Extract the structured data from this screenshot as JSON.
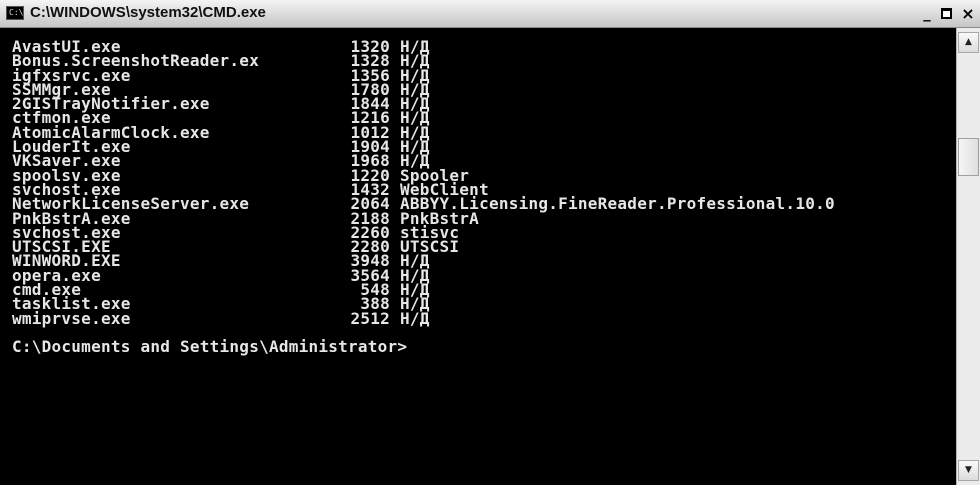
{
  "window": {
    "title": "C:\\WINDOWS\\system32\\CMD.exe",
    "icon_label": "C:\\",
    "controls": {
      "minimize": "_",
      "close": "×"
    }
  },
  "console": {
    "processes": [
      {
        "name": "AvastUI.exe",
        "pid": "1320",
        "service": "Н/Д"
      },
      {
        "name": "Bonus.ScreenshotReader.ex",
        "pid": "1328",
        "service": "Н/Д"
      },
      {
        "name": "igfxsrvc.exe",
        "pid": "1356",
        "service": "Н/Д"
      },
      {
        "name": "SSMMgr.exe",
        "pid": "1780",
        "service": "Н/Д"
      },
      {
        "name": "2GISTrayNotifier.exe",
        "pid": "1844",
        "service": "Н/Д"
      },
      {
        "name": "ctfmon.exe",
        "pid": "1216",
        "service": "Н/Д"
      },
      {
        "name": "AtomicAlarmClock.exe",
        "pid": "1012",
        "service": "Н/Д"
      },
      {
        "name": "LouderIt.exe",
        "pid": "1904",
        "service": "Н/Д"
      },
      {
        "name": "VKSaver.exe",
        "pid": "1968",
        "service": "Н/Д"
      },
      {
        "name": "spoolsv.exe",
        "pid": "1220",
        "service": "Spooler"
      },
      {
        "name": "svchost.exe",
        "pid": "1432",
        "service": "WebClient"
      },
      {
        "name": "NetworkLicenseServer.exe",
        "pid": "2064",
        "service": "ABBYY.Licensing.FineReader.Professional.10.0"
      },
      {
        "name": "PnkBstrA.exe",
        "pid": "2188",
        "service": "PnkBstrA"
      },
      {
        "name": "svchost.exe",
        "pid": "2260",
        "service": "stisvc"
      },
      {
        "name": "UTSCSI.EXE",
        "pid": "2280",
        "service": "UTSCSI"
      },
      {
        "name": "WINWORD.EXE",
        "pid": "3948",
        "service": "Н/Д"
      },
      {
        "name": "opera.exe",
        "pid": "3564",
        "service": "Н/Д"
      },
      {
        "name": "cmd.exe",
        "pid": "548",
        "service": "Н/Д"
      },
      {
        "name": "tasklist.exe",
        "pid": "388",
        "service": "Н/Д"
      },
      {
        "name": "wmiprvse.exe",
        "pid": "2512",
        "service": "Н/Д"
      }
    ],
    "prompt": "C:\\Documents and Settings\\Administrator>"
  },
  "scrollbar": {
    "up_arrow": "▲",
    "down_arrow": "▼"
  }
}
